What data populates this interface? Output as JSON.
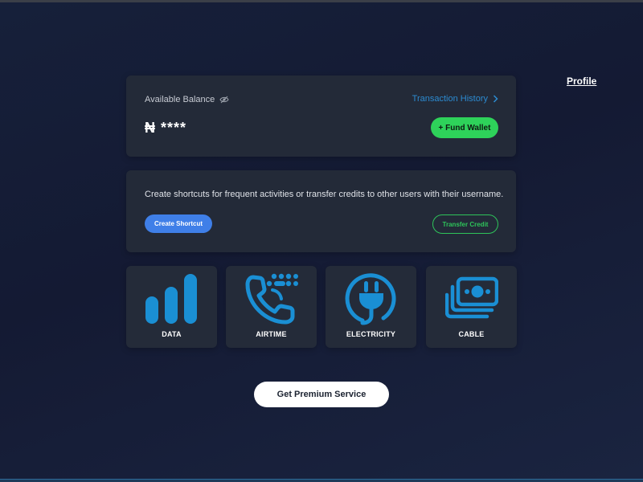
{
  "profile": {
    "label": "Profile"
  },
  "balance": {
    "label": "Available Balance",
    "amount": "₦ ****",
    "history_link": "Transaction History",
    "fund_button": "+ Fund Wallet"
  },
  "shortcuts": {
    "description": "Create shortcuts for frequent activities or transfer credits to other users with their username.",
    "create_button": "Create Shortcut",
    "transfer_button": "Transfer Credit"
  },
  "services": [
    {
      "label": "DATA",
      "icon": "signal-bars-icon"
    },
    {
      "label": "AIRTIME",
      "icon": "phone-keypad-icon"
    },
    {
      "label": "ELECTRICITY",
      "icon": "power-plug-icon"
    },
    {
      "label": "CABLE",
      "icon": "cash-stack-icon"
    }
  ],
  "premium_button": "Get Premium Service",
  "colors": {
    "accent_blue": "#2c8bd1",
    "fund_green": "#2ed25a",
    "create_blue": "#3f7fe8",
    "icon_blue": "#1a8fd4"
  }
}
